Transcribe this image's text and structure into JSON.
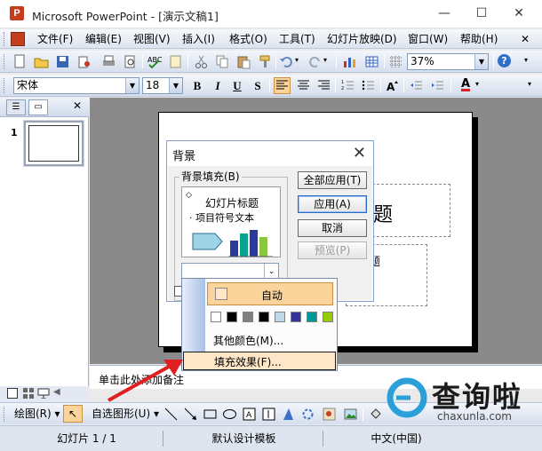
{
  "window": {
    "title": "Microsoft PowerPoint - [演示文稿1]",
    "minimize": "—",
    "maximize": "☐",
    "close": "✕"
  },
  "menubar": {
    "items": [
      "文件(F)",
      "编辑(E)",
      "视图(V)",
      "插入(I)",
      "格式(O)",
      "工具(T)",
      "幻灯片放映(D)",
      "窗口(W)",
      "帮助(H)"
    ]
  },
  "standard_toolbar": {
    "zoom": "37%"
  },
  "format_toolbar": {
    "font_name": "宋体",
    "font_size": "18",
    "bold": "B",
    "italic": "I",
    "underline": "U",
    "shadow": "S"
  },
  "left_pane": {
    "slide_number": "1"
  },
  "notes": {
    "text": "单击此处添加备注"
  },
  "slide": {
    "title_fragment": "题",
    "subtitle_fragment": "题"
  },
  "background_dialog": {
    "title": "背景",
    "close": "✕",
    "group_label": "背景填充(B)",
    "preview_title": "幻灯片标题",
    "preview_bullet": "· 项目符号文本",
    "buttons": {
      "apply_all": "全部应用(T)",
      "apply": "应用(A)",
      "cancel": "取消",
      "preview": "预览(P)"
    }
  },
  "color_menu": {
    "auto_label": "自动",
    "more_colors": "其他颜色(M)...",
    "fill_effects": "填充效果(F)...",
    "swatch_colors": [
      "#ffffff",
      "#000000",
      "#808080",
      "#000000",
      "#c0d8e8",
      "#333399",
      "#009999",
      "#99cc00"
    ]
  },
  "drawing_toolbar": {
    "draw_menu": "绘图(R)",
    "autoshapes": "自选图形(U)"
  },
  "statusbar": {
    "slide_indicator": "幻灯片 1 / 1",
    "design_template": "默认设计模板",
    "language": "中文(中国)"
  },
  "watermark": {
    "brand": "查询啦",
    "url": "chaxunla.com"
  },
  "colors": {
    "accent_orange": "#fbd49b",
    "annotation_red": "#e02020"
  }
}
